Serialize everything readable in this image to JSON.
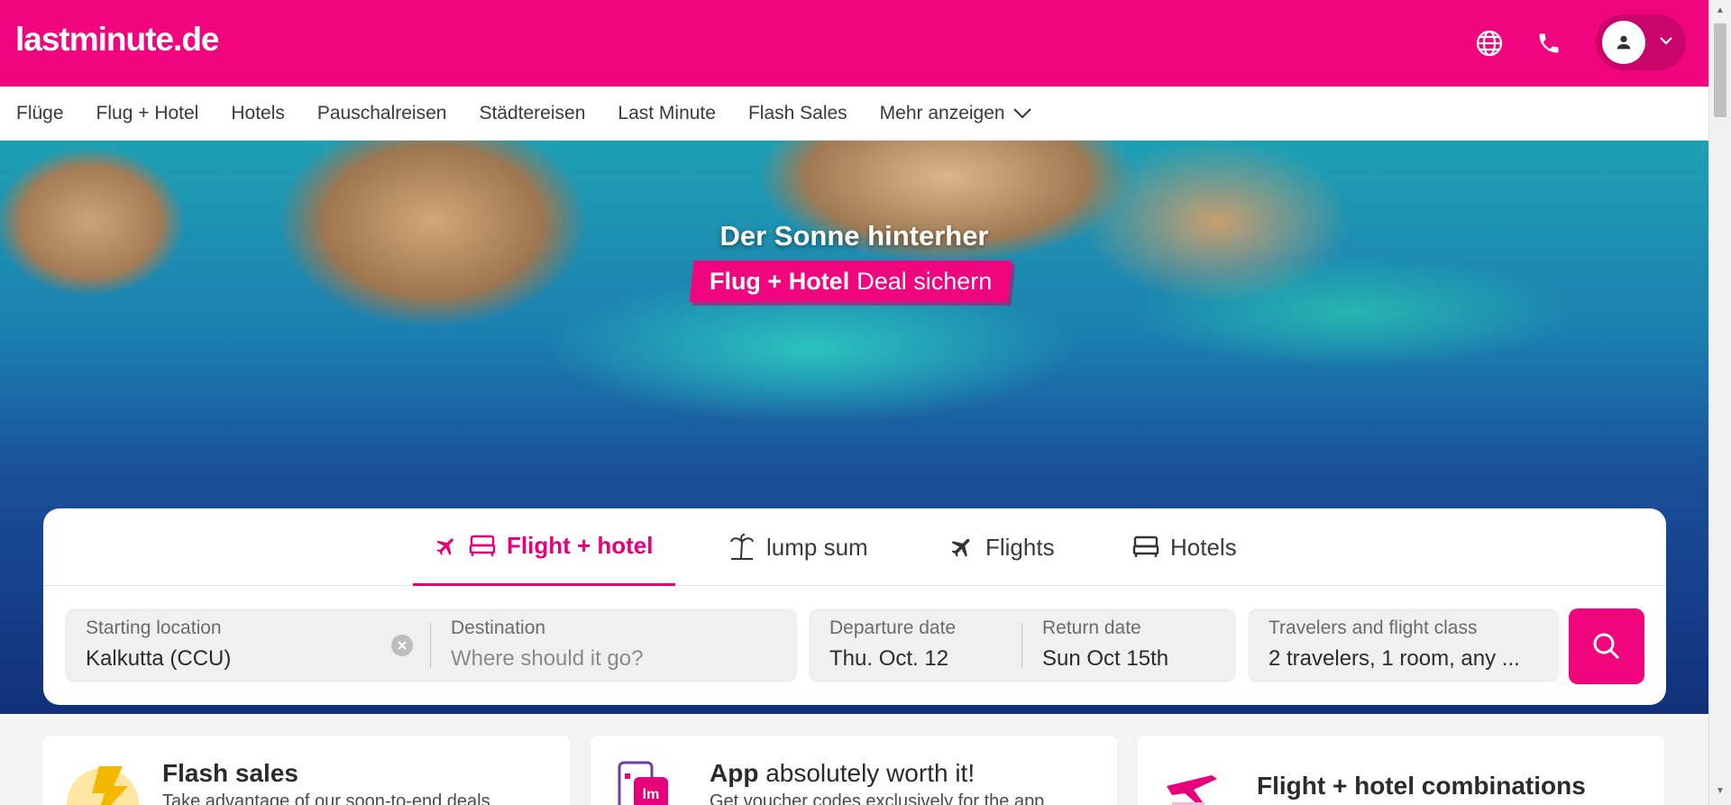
{
  "header": {
    "logo": "lastminute.de",
    "icons": [
      "globe-icon",
      "phone-icon",
      "user-icon",
      "chevron-down-icon"
    ]
  },
  "nav": {
    "items": [
      "Flüge",
      "Flug + Hotel",
      "Hotels",
      "Pauschalreisen",
      "Städtereisen",
      "Last Minute",
      "Flash Sales",
      "Mehr anzeigen"
    ]
  },
  "hero": {
    "title": "Der Sonne hinterher",
    "badge_bold": "Flug + Hotel",
    "badge_text": "Deal sichern"
  },
  "search": {
    "tabs": [
      {
        "label": "Flight + hotel",
        "active": true
      },
      {
        "label": "lump sum",
        "active": false
      },
      {
        "label": "Flights",
        "active": false
      },
      {
        "label": "Hotels",
        "active": false
      }
    ],
    "origin": {
      "label": "Starting location",
      "value": "Kalkutta (CCU)"
    },
    "destination": {
      "label": "Destination",
      "placeholder": "Where should it go?"
    },
    "departure": {
      "label": "Departure date",
      "value": "Thu. Oct. 12"
    },
    "return": {
      "label": "Return date",
      "value": "Sun Oct 15th"
    },
    "travelers": {
      "label": "Travelers and flight class",
      "value": "2 travelers, 1 room, any ..."
    }
  },
  "promos": [
    {
      "title_bold": "Flash sales",
      "title_rest": "",
      "subtitle": "Take advantage of our soon-to-end deals"
    },
    {
      "title_bold": "App",
      "title_rest": " absolutely worth it!",
      "subtitle": "Get voucher codes exclusively for the app"
    },
    {
      "title_bold": "Flight + hotel combinations",
      "title_rest": "",
      "subtitle": ""
    }
  ],
  "colors": {
    "brand": "#f0057f",
    "accent_text": "#e6007a"
  }
}
